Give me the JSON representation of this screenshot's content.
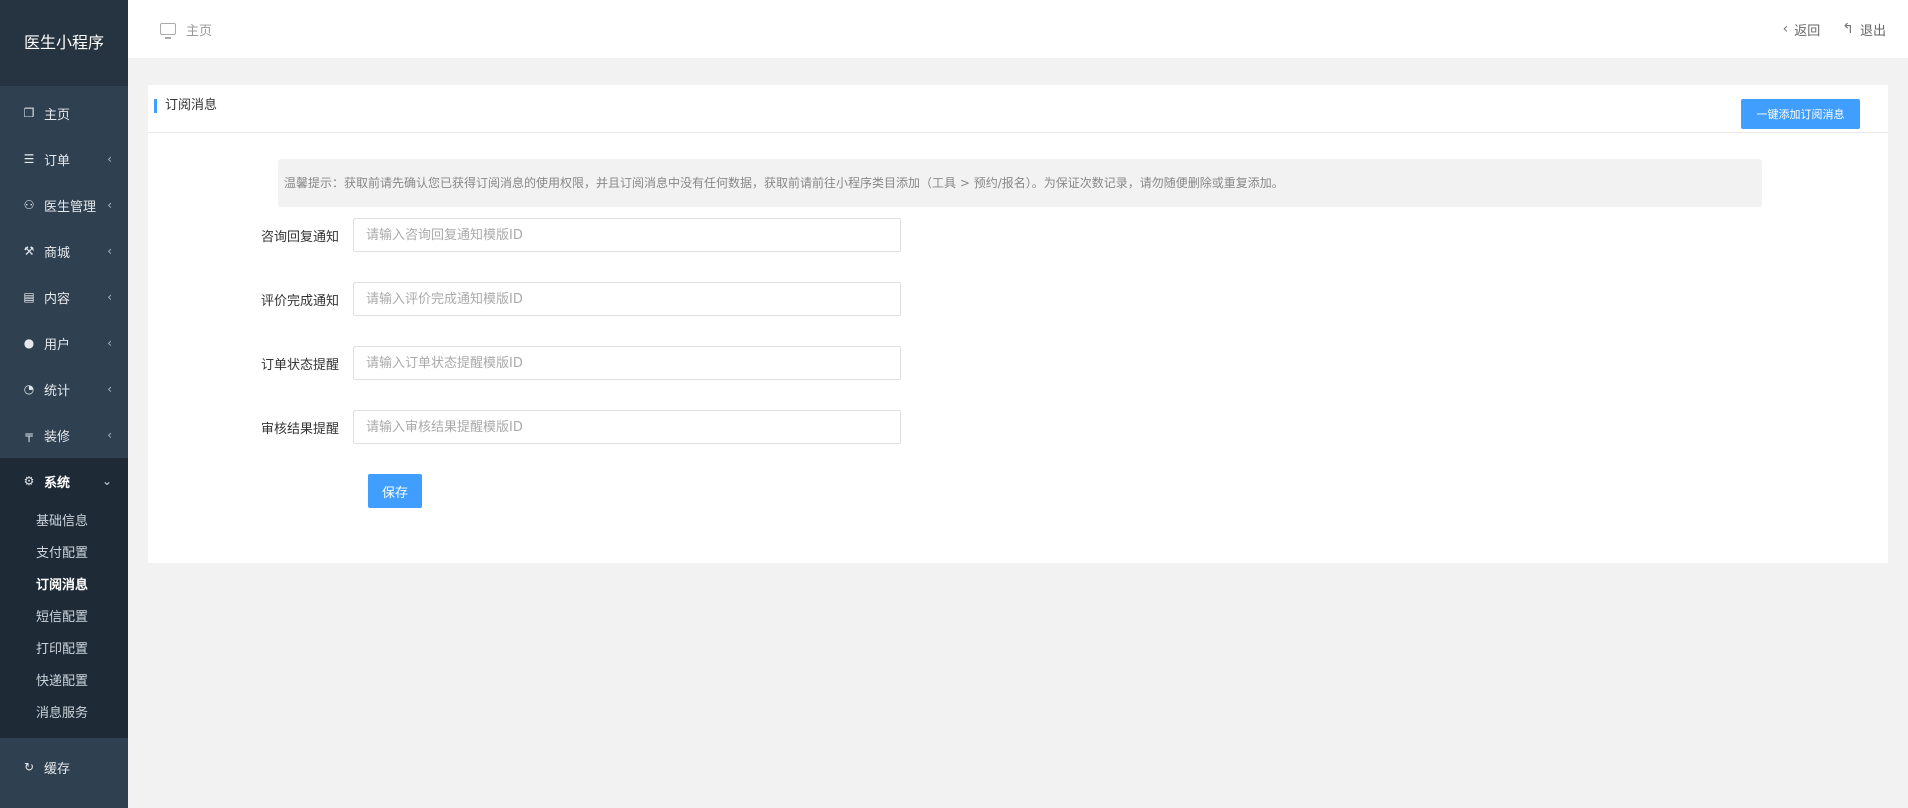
{
  "app": {
    "title": "医生小程序"
  },
  "sidebar": {
    "items": [
      {
        "label": "主页",
        "icon": "copy-icon"
      },
      {
        "label": "订单",
        "icon": "list-icon"
      },
      {
        "label": "医生管理",
        "icon": "user-outline-icon"
      },
      {
        "label": "商城",
        "icon": "gavel-icon"
      },
      {
        "label": "内容",
        "icon": "book-icon"
      },
      {
        "label": "用户",
        "icon": "user-icon"
      },
      {
        "label": "统计",
        "icon": "pie-chart-icon"
      },
      {
        "label": "装修",
        "icon": "decor-icon"
      },
      {
        "label": "系统",
        "icon": "gear-icon"
      }
    ],
    "system_sub": [
      "基础信息",
      "支付配置",
      "订阅消息",
      "短信配置",
      "打印配置",
      "快递配置",
      "消息服务"
    ],
    "cache": {
      "label": "缓存",
      "icon": "refresh-icon"
    }
  },
  "topbar": {
    "home_label": "主页",
    "back_label": "返回",
    "logout_label": "退出"
  },
  "panel": {
    "title": "订阅消息",
    "add_button": "一键添加订阅消息",
    "notice": "温馨提示：获取前请先确认您已获得订阅消息的使用权限，并且订阅消息中没有任何数据，获取前请前往小程序类目添加（工具 > 预约/报名）。为保证次数记录，请勿随便删除或重复添加。",
    "fields": [
      {
        "label": "咨询回复通知",
        "placeholder": "请输入咨询回复通知模版ID",
        "value": ""
      },
      {
        "label": "评价完成通知",
        "placeholder": "请输入评价完成通知模版ID",
        "value": ""
      },
      {
        "label": "订单状态提醒",
        "placeholder": "请输入订单状态提醒模版ID",
        "value": ""
      },
      {
        "label": "审核结果提醒",
        "placeholder": "请输入审核结果提醒模版ID",
        "value": ""
      }
    ],
    "save_button": "保存"
  },
  "colors": {
    "sidebar": "#2f4050",
    "accent": "#409eff"
  }
}
